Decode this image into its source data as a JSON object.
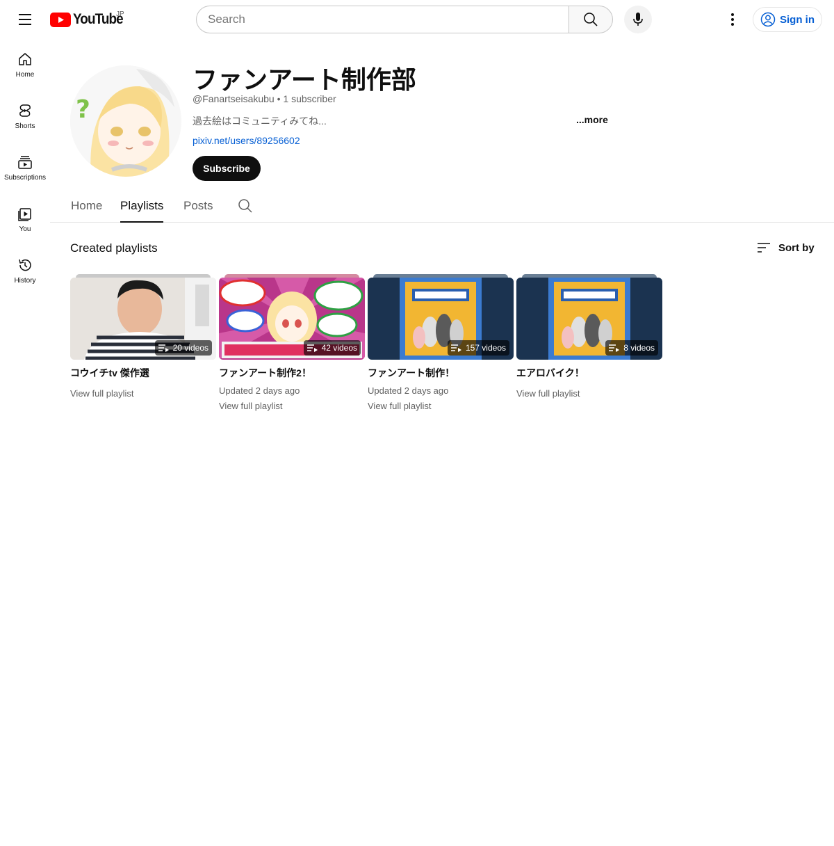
{
  "header": {
    "logo_text": "YouTube",
    "region": "JP",
    "search_placeholder": "Search",
    "signin_label": "Sign in"
  },
  "guide": {
    "items": [
      {
        "label": "Home",
        "icon": "home-icon"
      },
      {
        "label": "Shorts",
        "icon": "shorts-icon"
      },
      {
        "label": "Subscriptions",
        "icon": "subscriptions-icon"
      },
      {
        "label": "You",
        "icon": "you-icon"
      },
      {
        "label": "History",
        "icon": "history-icon"
      }
    ]
  },
  "channel": {
    "name": "ファンアート制作部",
    "meta": "@Fanartseisakubu • 1 subscriber",
    "description": "過去絵はコミュニティみてね...",
    "more_label": "...more",
    "link": "pixiv.net/users/89256602",
    "subscribe_label": "Subscribe"
  },
  "tabs": [
    {
      "label": "Home",
      "active": false
    },
    {
      "label": "Playlists",
      "active": true
    },
    {
      "label": "Posts",
      "active": false
    }
  ],
  "section": {
    "title": "Created playlists",
    "sort_label": "Sort by"
  },
  "playlists": [
    {
      "title": "コウイチtv 傑作選",
      "count": "20 videos",
      "updated": "",
      "view_label": "View full playlist"
    },
    {
      "title": "ファンアート制作2！",
      "count": "42 videos",
      "updated": "Updated 2 days ago",
      "view_label": "View full playlist"
    },
    {
      "title": "ファンアート制作！",
      "count": "157 videos",
      "updated": "Updated 2 days ago",
      "view_label": "View full playlist"
    },
    {
      "title": "エアロバイク！",
      "count": "8 videos",
      "updated": "",
      "view_label": "View full playlist"
    }
  ],
  "colors": {
    "brand_red": "#ff0000",
    "link_blue": "#065fd4",
    "text_primary": "#0f0f0f",
    "text_secondary": "#606060"
  }
}
